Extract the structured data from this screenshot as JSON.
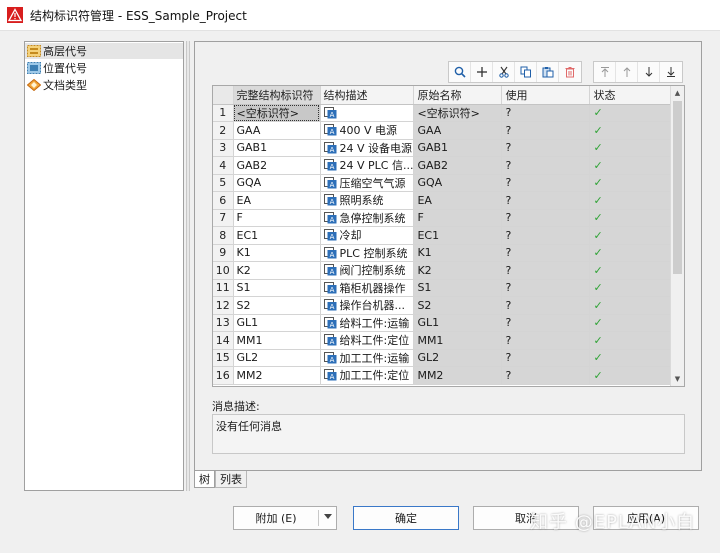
{
  "window": {
    "title": "结构标识符管理 - ESS_Sample_Project"
  },
  "tree": {
    "items": [
      {
        "label": "高层代号",
        "icon": "high-level-code-icon",
        "selected": true
      },
      {
        "label": "位置代号",
        "icon": "location-code-icon",
        "selected": false
      },
      {
        "label": "文档类型",
        "icon": "document-type-icon",
        "selected": false
      }
    ]
  },
  "toolbar": {
    "group1": [
      "search-icon",
      "add-icon",
      "cut-icon",
      "copy-icon",
      "paste-icon",
      "delete-icon"
    ],
    "group2": [
      "move-top-icon",
      "move-up-icon",
      "move-down-icon",
      "move-bottom-icon"
    ]
  },
  "grid": {
    "columns": [
      "完整结构标识符",
      "结构描述",
      "原始名称",
      "使用",
      "状态"
    ],
    "rows": [
      {
        "num": "1",
        "id": "<空标识符>",
        "desc": "",
        "orig": "<空标识符>",
        "use": "?",
        "status": "✓"
      },
      {
        "num": "2",
        "id": "GAA",
        "desc": "400 V 电源",
        "orig": "GAA",
        "use": "?",
        "status": "✓"
      },
      {
        "num": "3",
        "id": "GAB1",
        "desc": "24 V 设备电源",
        "orig": "GAB1",
        "use": "?",
        "status": "✓"
      },
      {
        "num": "4",
        "id": "GAB2",
        "desc": "24 V PLC 信...",
        "orig": "GAB2",
        "use": "?",
        "status": "✓"
      },
      {
        "num": "5",
        "id": "GQA",
        "desc": "压缩空气气源",
        "orig": "GQA",
        "use": "?",
        "status": "✓"
      },
      {
        "num": "6",
        "id": "EA",
        "desc": "照明系统",
        "orig": "EA",
        "use": "?",
        "status": "✓"
      },
      {
        "num": "7",
        "id": "F",
        "desc": "急停控制系统",
        "orig": "F",
        "use": "?",
        "status": "✓"
      },
      {
        "num": "8",
        "id": "EC1",
        "desc": "冷却",
        "orig": "EC1",
        "use": "?",
        "status": "✓"
      },
      {
        "num": "9",
        "id": "K1",
        "desc": "PLC 控制系统",
        "orig": "K1",
        "use": "?",
        "status": "✓"
      },
      {
        "num": "10",
        "id": "K2",
        "desc": "阀门控制系统",
        "orig": "K2",
        "use": "?",
        "status": "✓"
      },
      {
        "num": "11",
        "id": "S1",
        "desc": "箱柜机器操作",
        "orig": "S1",
        "use": "?",
        "status": "✓"
      },
      {
        "num": "12",
        "id": "S2",
        "desc": "操作台机器...",
        "orig": "S2",
        "use": "?",
        "status": "✓"
      },
      {
        "num": "13",
        "id": "GL1",
        "desc": "给料工件:运输",
        "orig": "GL1",
        "use": "?",
        "status": "✓"
      },
      {
        "num": "14",
        "id": "MM1",
        "desc": "给料工件:定位",
        "orig": "MM1",
        "use": "?",
        "status": "✓"
      },
      {
        "num": "15",
        "id": "GL2",
        "desc": "加工工件:运输",
        "orig": "GL2",
        "use": "?",
        "status": "✓"
      },
      {
        "num": "16",
        "id": "MM2",
        "desc": "加工工件:定位",
        "orig": "MM2",
        "use": "?",
        "status": "✓"
      }
    ]
  },
  "messages": {
    "label": "消息描述:",
    "text": "没有任何消息"
  },
  "tabs": [
    {
      "label": "树",
      "active": true
    },
    {
      "label": "列表",
      "active": false
    }
  ],
  "buttons": {
    "extra": "附加 (E)",
    "ok": "确定",
    "cancel": "取消",
    "apply": "应用(A)"
  },
  "watermark": "知乎 @EPLAN小白",
  "colors": {
    "title_icon": "#d81e1e",
    "check": "#2fa335",
    "readonly_cell": "#d6d6d6",
    "primary_border": "#3a78c8"
  }
}
